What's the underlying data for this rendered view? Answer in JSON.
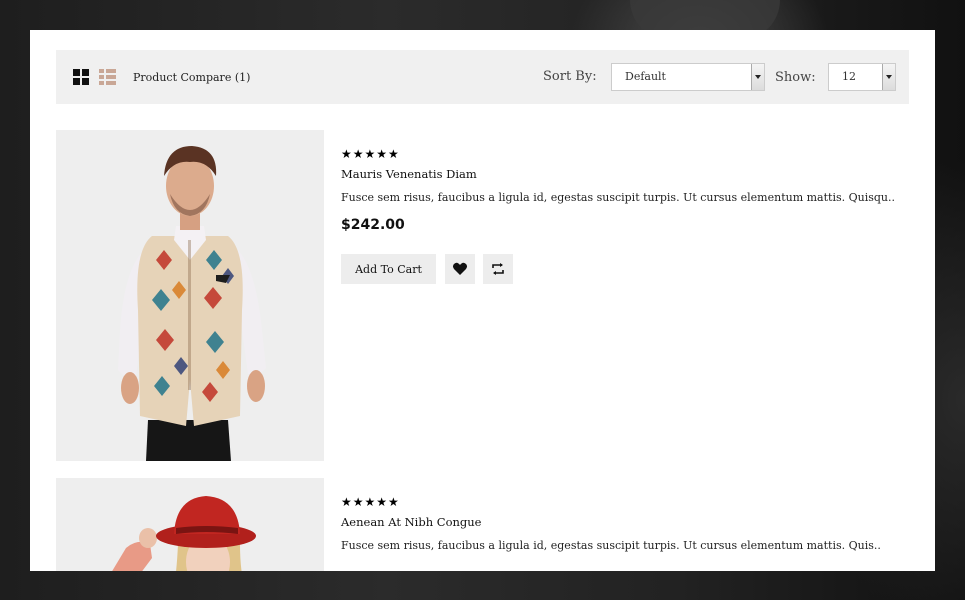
{
  "toolbar": {
    "compare_label": "Product Compare (1)",
    "sort_label": "Sort By:",
    "sort_value": "Default",
    "show_label": "Show:",
    "show_value": "12"
  },
  "products": [
    {
      "rating": "★★★★★",
      "name": "Mauris Venenatis Diam",
      "description": "Fusce sem risus, faucibus a ligula id, egestas suscipit turpis. Ut cursus elementum mattis. Quisqu..",
      "price": "$242.00",
      "add_to_cart_label": "Add To Cart"
    },
    {
      "rating": "★★★★★",
      "name": "Aenean At Nibh Congue",
      "description": "Fusce sem risus, faucibus a ligula id, egestas suscipit turpis. Ut cursus elementum mattis. Quis.."
    }
  ],
  "icons": {
    "grid_view": "grid-icon",
    "list_view": "list-icon",
    "wishlist": "heart-icon",
    "compare": "compare-arrows-icon"
  },
  "colors": {
    "toolbar_bg": "#f0f0f0",
    "button_bg": "#ededed",
    "list_icon_accent": "#c9a796"
  }
}
